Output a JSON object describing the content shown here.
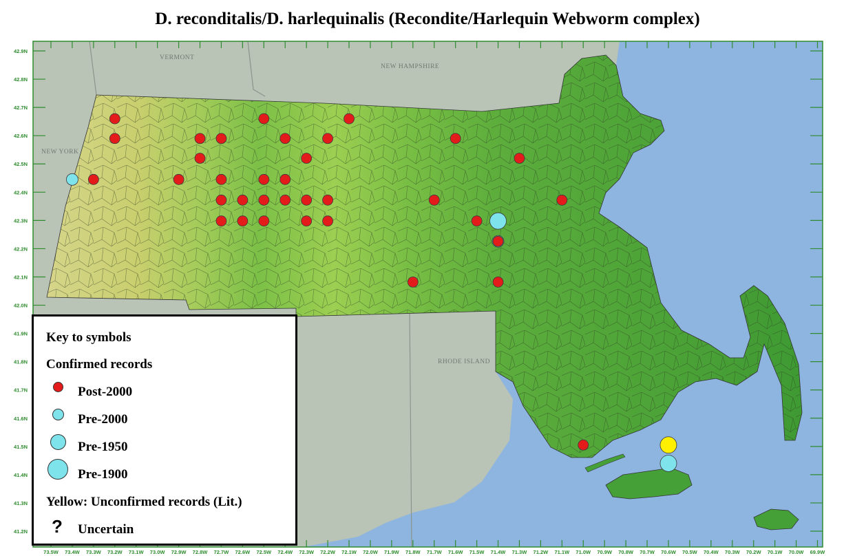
{
  "title": "D. reconditalis/D. harlequinalis (Recondite/Harlequin Webworm complex)",
  "colors": {
    "ocean": "#8eb4e0",
    "neighbor_land": "#b9c4b7",
    "post2000": "#e41b1b",
    "pre2000": "#7fe3ec",
    "pre1950": "#7fe3ec",
    "pre1900": "#7fe3ec",
    "unconfirmed": "#ffef00",
    "tick_labels": "#2e8b2e"
  },
  "axes": {
    "lat_labels": [
      "42.9N",
      "42.8N",
      "42.7N",
      "42.6N",
      "42.5N",
      "42.4N",
      "42.3N",
      "42.2N",
      "42.1N",
      "42.0N",
      "41.9N",
      "41.8N",
      "41.7N",
      "41.6N",
      "41.5N",
      "41.4N",
      "41.3N",
      "41.2N"
    ],
    "lon_labels": [
      "73.5W",
      "73.4W",
      "73.3W",
      "73.2W",
      "73.1W",
      "73.0W",
      "72.9W",
      "72.8W",
      "72.7W",
      "72.6W",
      "72.5W",
      "72.4W",
      "72.3W",
      "72.2W",
      "72.1W",
      "72.0W",
      "71.9W",
      "71.8W",
      "71.7W",
      "71.6W",
      "71.5W",
      "71.4W",
      "71.3W",
      "71.2W",
      "71.1W",
      "71.0W",
      "70.9W",
      "70.8W",
      "70.7W",
      "70.6W",
      "70.5W",
      "70.4W",
      "70.3W",
      "70.2W",
      "70.1W",
      "70.0W",
      "69.9W"
    ],
    "lat_range": [
      41.2,
      42.9
    ],
    "lon_range": [
      -73.5,
      -69.9
    ]
  },
  "state_labels": [
    "VERMONT",
    "NEW HAMPSHIRE",
    "NEW YORK",
    "RHODE ISLAND"
  ],
  "records": [
    {
      "lon": -73.2,
      "lat": 42.66,
      "type": "post2000"
    },
    {
      "lon": -73.2,
      "lat": 42.59,
      "type": "post2000"
    },
    {
      "lon": -72.5,
      "lat": 42.66,
      "type": "post2000"
    },
    {
      "lon": -72.1,
      "lat": 42.66,
      "type": "post2000"
    },
    {
      "lon": -72.8,
      "lat": 42.59,
      "type": "post2000"
    },
    {
      "lon": -72.7,
      "lat": 42.59,
      "type": "post2000"
    },
    {
      "lon": -72.4,
      "lat": 42.59,
      "type": "post2000"
    },
    {
      "lon": -72.2,
      "lat": 42.59,
      "type": "post2000"
    },
    {
      "lon": -71.6,
      "lat": 42.59,
      "type": "post2000"
    },
    {
      "lon": -72.8,
      "lat": 42.52,
      "type": "post2000"
    },
    {
      "lon": -72.3,
      "lat": 42.52,
      "type": "post2000"
    },
    {
      "lon": -71.3,
      "lat": 42.52,
      "type": "post2000"
    },
    {
      "lon": -73.3,
      "lat": 42.445,
      "type": "post2000"
    },
    {
      "lon": -72.9,
      "lat": 42.445,
      "type": "post2000"
    },
    {
      "lon": -72.7,
      "lat": 42.445,
      "type": "post2000"
    },
    {
      "lon": -72.5,
      "lat": 42.445,
      "type": "post2000"
    },
    {
      "lon": -72.4,
      "lat": 42.445,
      "type": "post2000"
    },
    {
      "lon": -72.7,
      "lat": 42.372,
      "type": "post2000"
    },
    {
      "lon": -72.6,
      "lat": 42.372,
      "type": "post2000"
    },
    {
      "lon": -72.5,
      "lat": 42.372,
      "type": "post2000"
    },
    {
      "lon": -72.4,
      "lat": 42.372,
      "type": "post2000"
    },
    {
      "lon": -72.3,
      "lat": 42.372,
      "type": "post2000"
    },
    {
      "lon": -72.2,
      "lat": 42.372,
      "type": "post2000"
    },
    {
      "lon": -71.7,
      "lat": 42.372,
      "type": "post2000"
    },
    {
      "lon": -71.1,
      "lat": 42.372,
      "type": "post2000"
    },
    {
      "lon": -72.7,
      "lat": 42.298,
      "type": "post2000"
    },
    {
      "lon": -72.6,
      "lat": 42.298,
      "type": "post2000"
    },
    {
      "lon": -72.5,
      "lat": 42.298,
      "type": "post2000"
    },
    {
      "lon": -72.3,
      "lat": 42.298,
      "type": "post2000"
    },
    {
      "lon": -72.2,
      "lat": 42.298,
      "type": "post2000"
    },
    {
      "lon": -71.5,
      "lat": 42.298,
      "type": "post2000"
    },
    {
      "lon": -71.4,
      "lat": 42.298,
      "type": "pre1950"
    },
    {
      "lon": -71.4,
      "lat": 42.226,
      "type": "pre2000"
    },
    {
      "lon": -71.4,
      "lat": 42.226,
      "type": "post2000"
    },
    {
      "lon": -73.4,
      "lat": 42.445,
      "type": "pre2000"
    },
    {
      "lon": -71.8,
      "lat": 42.082,
      "type": "post2000"
    },
    {
      "lon": -71.4,
      "lat": 42.082,
      "type": "post2000"
    },
    {
      "lon": -71.0,
      "lat": 41.505,
      "type": "post2000"
    },
    {
      "lon": -70.6,
      "lat": 41.505,
      "type": "unconfirmed"
    },
    {
      "lon": -70.6,
      "lat": 41.44,
      "type": "pre1950"
    }
  ],
  "legend": {
    "key_title": "Key to symbols",
    "confirmed_title": "Confirmed records",
    "items": [
      {
        "label": "Post-2000",
        "color": "#e41b1b",
        "size": "small"
      },
      {
        "label": "Pre-2000",
        "color": "#7fe3ec",
        "size": "small"
      },
      {
        "label": "Pre-1950",
        "color": "#7fe3ec",
        "size": "medium"
      },
      {
        "label": "Pre-1900",
        "color": "#7fe3ec",
        "size": "large"
      }
    ],
    "unconfirmed_label": "Yellow: Unconfirmed records (Lit.)",
    "uncertain_symbol": "?",
    "uncertain_label": "Uncertain"
  }
}
